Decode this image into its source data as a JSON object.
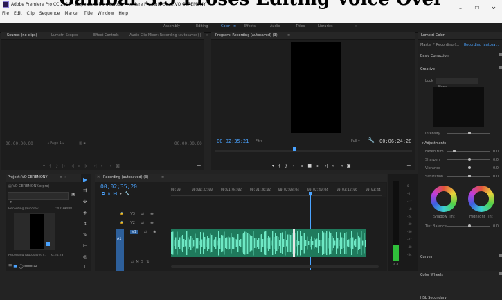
{
  "overlay_title": "Gambar 3.5 Proses Editing Voice Over",
  "window": {
    "title": "Adobe Premiere Pro CC 2017 - D:\\podcast baru\\Adobe Premiere Pro Auto-Save\\VO CEREMONY *",
    "minimize": "–",
    "maximize": "☐",
    "close": "✕"
  },
  "menu": [
    "File",
    "Edit",
    "Clip",
    "Sequence",
    "Marker",
    "Title",
    "Window",
    "Help"
  ],
  "workspaces": [
    "Assembly",
    "Editing",
    "Color",
    "Effects",
    "Audio",
    "Titles",
    "Libraries",
    "»"
  ],
  "source_panel": {
    "tabs": [
      "Source: (no clips)",
      "Lumetri Scopes",
      "Effect Controls",
      "Audio Clip Mixer: Recording (autosaved) |",
      "»"
    ],
    "timecode_left": "00;00;00;00",
    "page_label": "Page 1",
    "timecode_right": "00;00;00;00"
  },
  "program_panel": {
    "tab": "Program: Recording (autosaved) (3)",
    "timecode": "00;02;35;21",
    "fit": "Fit",
    "full": "Full",
    "duration": "00;06;24;28"
  },
  "lumetri": {
    "tab": "Lumetri Color",
    "master": "Master * Recording (...",
    "clip": "Recording (autosa...",
    "basic_correction": "Basic Correction",
    "creative": "Creative",
    "look": "Look",
    "look_value": "None",
    "intensity": "Intensity",
    "adjustments": "Adjustments",
    "faded_film": "Faded Film",
    "sharpen": "Sharpen",
    "vibrance": "Vibrance",
    "saturation": "Saturation",
    "shadow_tint": "Shadow Tint",
    "highlight_tint": "Highlight Tint",
    "tint_balance": "Tint Balance",
    "curves": "Curves",
    "color_wheels": "Color Wheels",
    "hsl_secondary": "HSL Secondary",
    "values": [
      "0.0",
      "0.0",
      "0.0",
      "0.0",
      "0.0",
      "0.0"
    ]
  },
  "project_panel": {
    "tab": "Project: VO CEREMONY",
    "item_name": "VO CEREMONY.prproj",
    "clip1": "Recording (autosav...",
    "clip1_dur": "7:43:39488",
    "clip2": "Recording (autosaved)...",
    "clip2_dur": "6:24:28"
  },
  "timeline": {
    "tab": "Recording (autosaved) (3)",
    "timecode": "00;02;35;20",
    "ruler": [
      "00;00",
      "00;00;32;00",
      "00;01;04;02",
      "00;01;36;02",
      "00;02;08;04",
      "00;02;40;04",
      "00;03;12;06",
      "00;03;44"
    ],
    "tracks": [
      "V3",
      "V2",
      "V1",
      "A1"
    ]
  },
  "meter": {
    "scale": [
      "0",
      "-6",
      "-12",
      "-18",
      "-24",
      "-30",
      "-36",
      "-42",
      "-48",
      "-54"
    ],
    "ss": "S S"
  }
}
